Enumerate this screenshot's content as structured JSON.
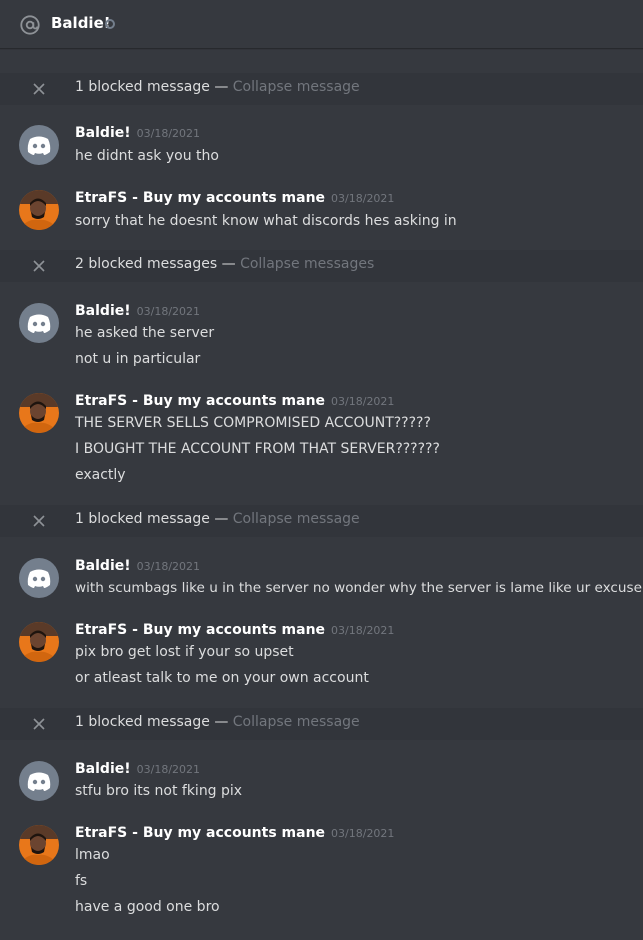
{
  "header": {
    "channel": "Baldie!"
  },
  "blocked": [
    {
      "count_text": "1 blocked message",
      "sep": "—",
      "action": "Collapse message"
    },
    {
      "count_text": "2 blocked messages",
      "sep": "—",
      "action": "Collapse messages"
    },
    {
      "count_text": "1 blocked message",
      "sep": "—",
      "action": "Collapse message"
    },
    {
      "count_text": "1 blocked message",
      "sep": "—",
      "action": "Collapse message"
    }
  ],
  "users": {
    "baldie": "Baldie!",
    "etra": "EtraFS - Buy my accounts mane"
  },
  "timestamp": "03/18/2021",
  "messages": [
    {
      "lines": [
        "he didnt ask you tho"
      ]
    },
    {
      "lines": [
        "sorry that he doesnt know what discords hes asking in"
      ]
    },
    {
      "lines": [
        "he asked the server",
        "not u in particular"
      ]
    },
    {
      "lines": [
        "THE SERVER SELLS COMPROMISED ACCOUNT?????",
        "I BOUGHT THE ACCOUNT FROM THAT SERVER??????",
        "exactly"
      ]
    },
    {
      "lines": [
        "with scumbags like u in the server no wonder why the server is lame like ur excuse"
      ]
    },
    {
      "lines": [
        "pix bro get lost if your so upset",
        "or atleast talk to me on your own account"
      ]
    },
    {
      "lines": [
        "stfu bro its not fking pix"
      ]
    },
    {
      "lines": [
        "lmao",
        "fs",
        "have a good one bro"
      ]
    }
  ],
  "colors": {
    "background": "#36393f",
    "blocked_bar": "#32353b",
    "discord_blurple_grey": "#747f8d",
    "muted_text": "#72767d",
    "avatar_orange": "#e8771a"
  }
}
